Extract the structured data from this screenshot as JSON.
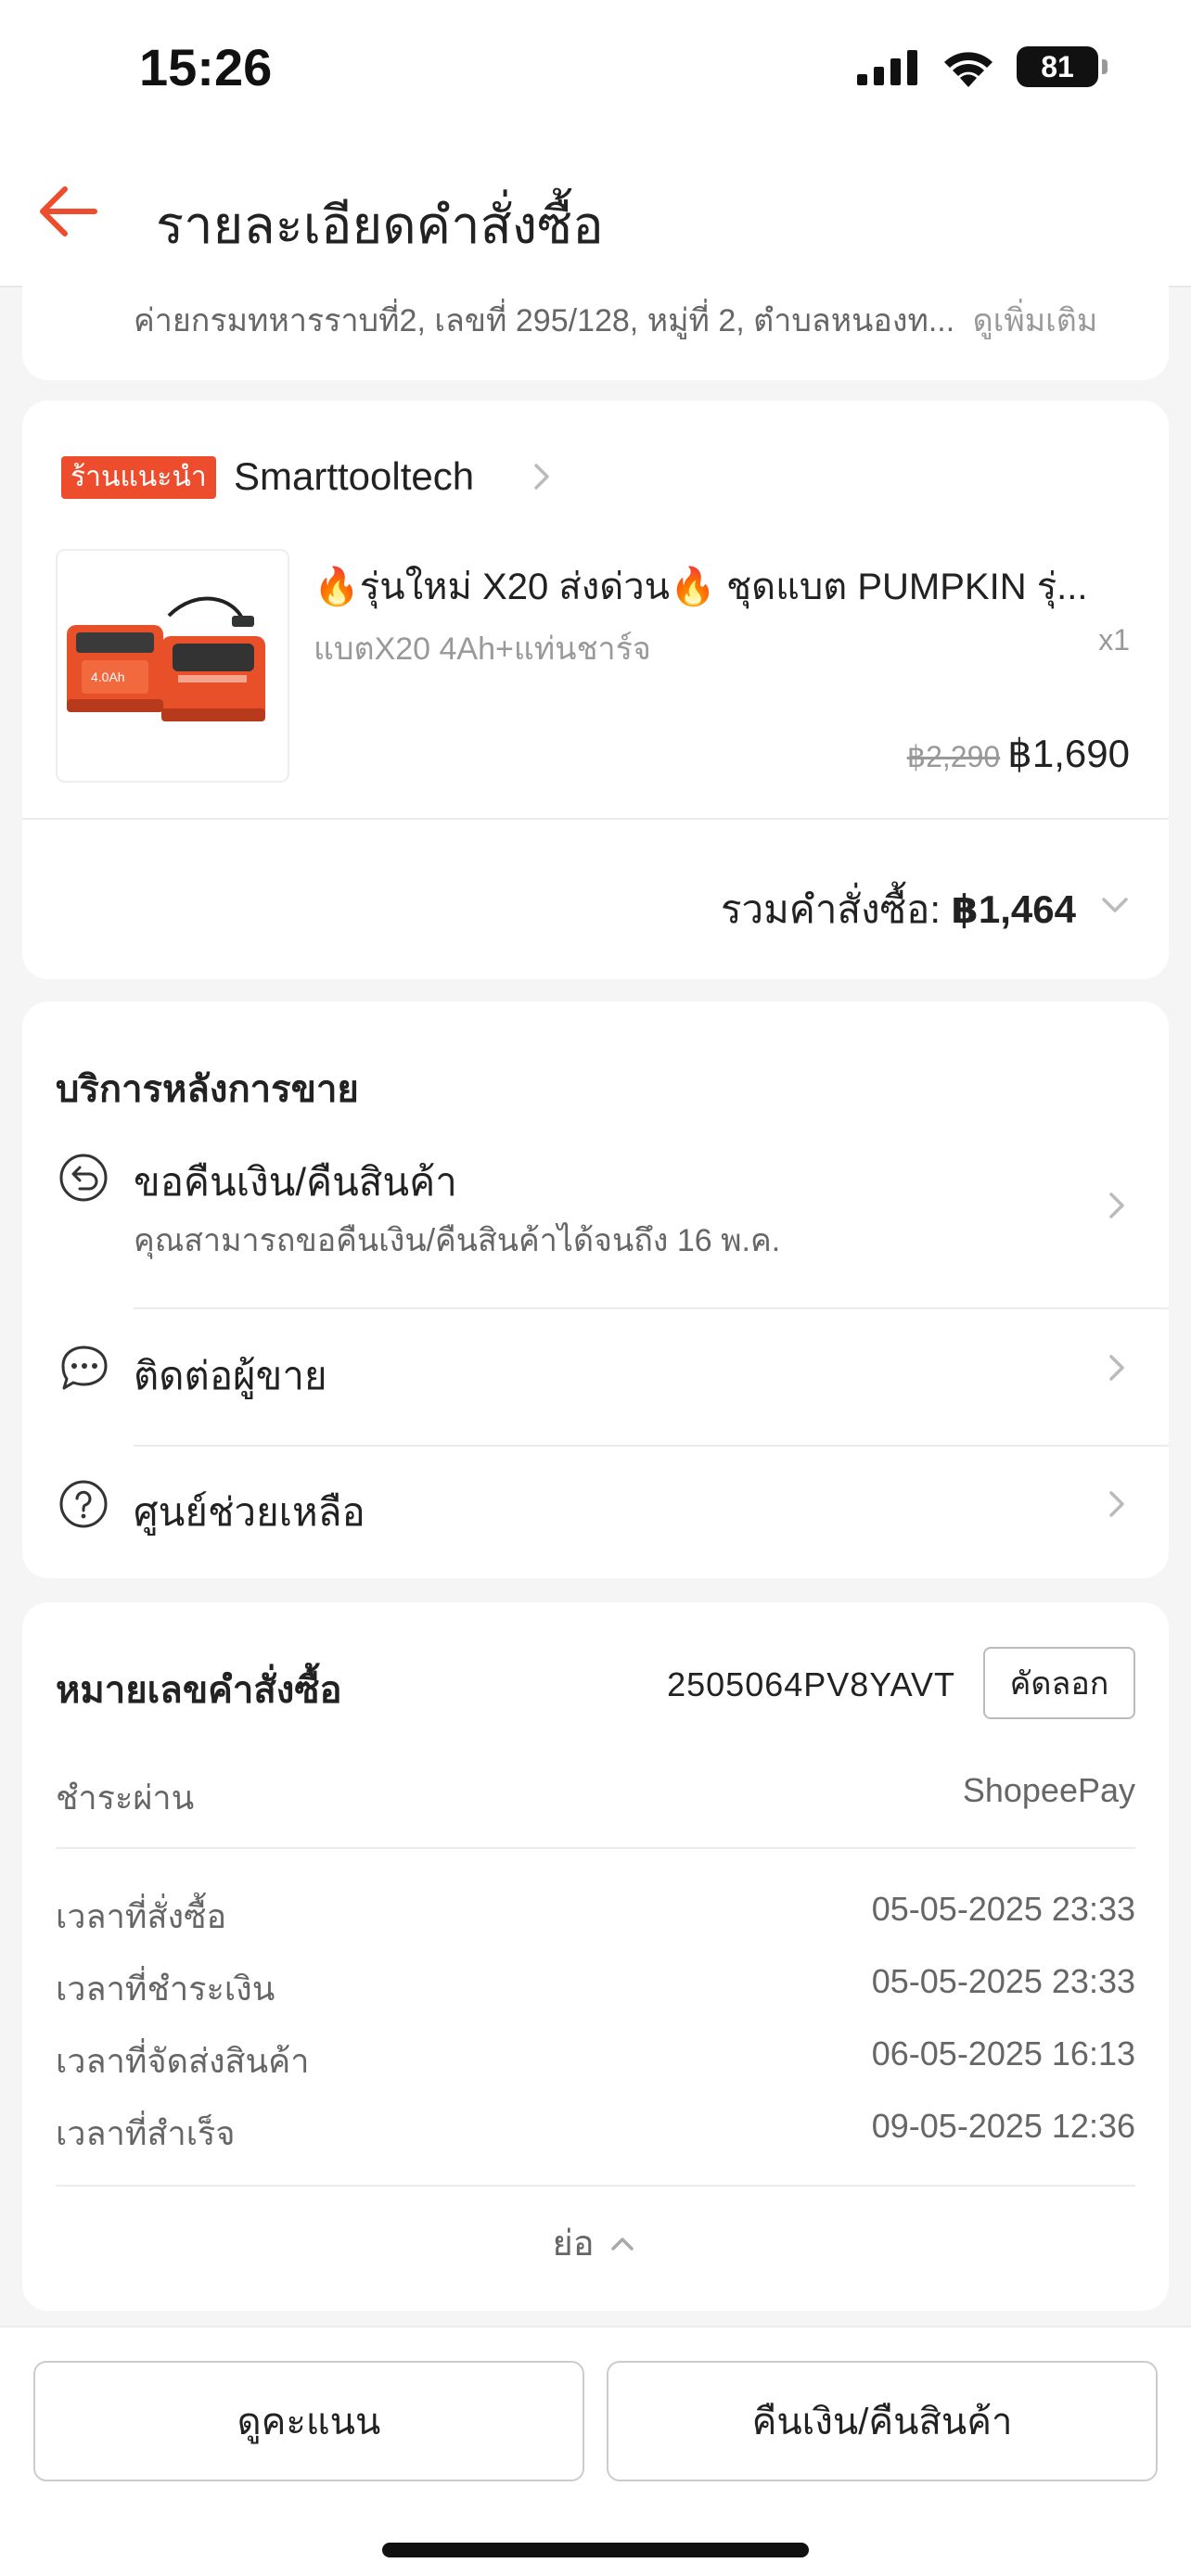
{
  "status_bar": {
    "time": "15:26",
    "battery": "81"
  },
  "nav": {
    "title": "รายละเอียดคำสั่งซื้อ"
  },
  "address": {
    "text": "ค่ายกรมทหารราบที่2, เลขที่ 295/128, หมู่ที่ 2, ตำบลหนองท...",
    "more": "ดูเพิ่มเติม"
  },
  "shop": {
    "badge": "ร้านแนะนำ",
    "name": "Smarttooltech",
    "product": {
      "title": "🔥รุ่นใหม่ X20 ส่งด่วน🔥 ชุดแบต PUMPKIN รุ่...",
      "variant": "แบตX20 4Ah+แท่นชาร์จ",
      "qty": "x1",
      "price_old": "฿2,290",
      "price_new": "฿1,690"
    },
    "total_label": "รวมคำสั่งซื้อ: ",
    "total_amount": "฿1,464"
  },
  "service": {
    "title": "บริการหลังการขาย",
    "items": [
      {
        "label": "ขอคืนเงิน/คืนสินค้า",
        "sub": "คุณสามารถขอคืนเงิน/คืนสินค้าได้จนถึง 16 พ.ค.",
        "icon": "return-icon"
      },
      {
        "label": "ติดต่อผู้ขาย",
        "icon": "chat-icon"
      },
      {
        "label": "ศูนย์ช่วยเหลือ",
        "icon": "help-icon"
      }
    ]
  },
  "order": {
    "id_label": "หมายเลขคำสั่งซื้อ",
    "id_value": "2505064PV8YAVT",
    "copy_label": "คัดลอก",
    "payment_label": "ชำระผ่าน",
    "payment_value": "ShopeePay",
    "times": [
      {
        "label": "เวลาที่สั่งซื้อ",
        "value": "05-05-2025 23:33"
      },
      {
        "label": "เวลาที่ชำระเงิน",
        "value": "05-05-2025 23:33"
      },
      {
        "label": "เวลาที่จัดส่งสินค้า",
        "value": "06-05-2025 16:13"
      },
      {
        "label": "เวลาที่สำเร็จ",
        "value": "09-05-2025 12:36"
      }
    ],
    "collapse_label": "ย่อ"
  },
  "bottom": {
    "rate_label": "ดูคะแนน",
    "refund_label": "คืนเงิน/คืนสินค้า"
  },
  "colors": {
    "accent": "#ee4d2d",
    "background": "#f5f5f5"
  }
}
